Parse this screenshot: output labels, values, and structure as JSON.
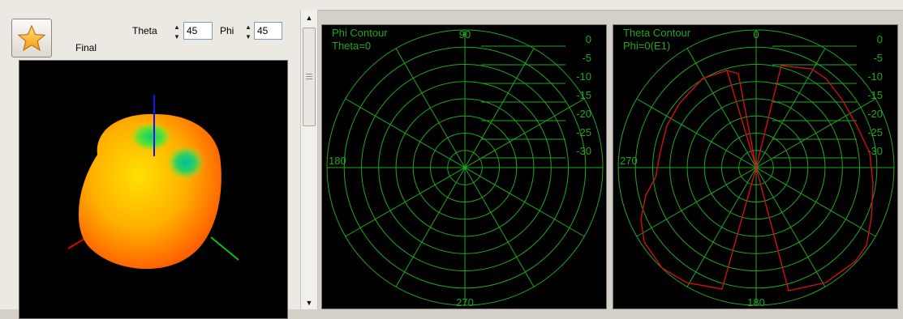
{
  "toolbar": {
    "final_label": "Final",
    "theta_label": "Theta",
    "theta_value": "45",
    "phi_label": "Phi",
    "phi_value": "45",
    "star_icon": "star-icon"
  },
  "colors": {
    "grid": "#1ea81e",
    "trace": "#d01010",
    "background": "#000000",
    "axis_x": "#e00000",
    "axis_y": "#10c010",
    "axis_z": "#1010ff"
  },
  "phi_panel": {
    "title": "Phi Contour",
    "subtitle": "Theta=0",
    "angle_top": "90",
    "angle_left": "180",
    "angle_bottom": "270",
    "db_scale": [
      "0",
      "-5",
      "-10",
      "-15",
      "-20",
      "-25",
      "-30"
    ]
  },
  "theta_panel": {
    "title": "Theta Contour",
    "subtitle": "Phi=0(E1)",
    "angle_top": "0",
    "angle_left": "270",
    "angle_bottom": "180",
    "db_scale": [
      "0",
      "-5",
      "-10",
      "-15",
      "-20",
      "-25",
      "-30"
    ]
  }
}
